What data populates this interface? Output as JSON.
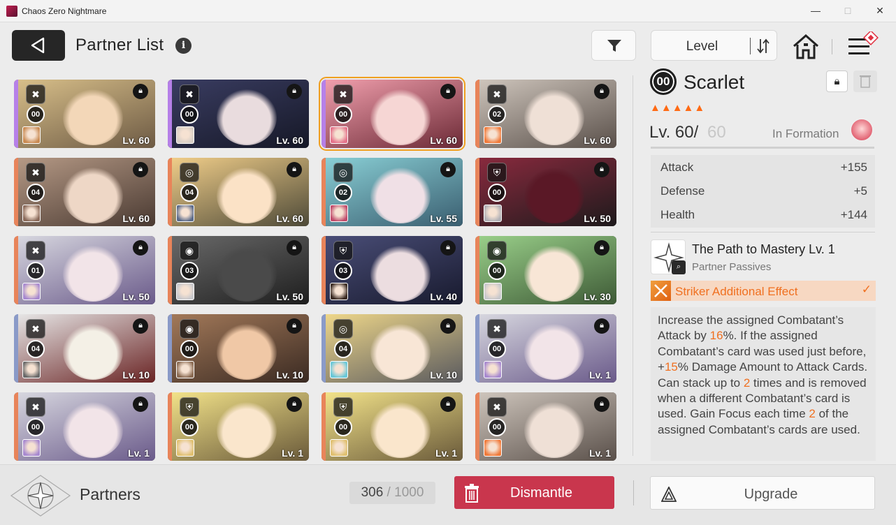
{
  "window": {
    "title": "Chaos Zero Nightmare",
    "minimize": "—",
    "maximize": "□",
    "close": "✕"
  },
  "header": {
    "title": "Partner List",
    "info_icon": "i",
    "sort_label": "Level"
  },
  "cards": [
    {
      "class_icon": "✖",
      "rank": "00",
      "level": "Lv. 60",
      "art": [
        "#d9c08a",
        "#6d5a44"
      ],
      "strip": "#b680e8",
      "face": "#f3d7b8",
      "mini": "#c98a52",
      "selected": false
    },
    {
      "class_icon": "✖",
      "rank": "00",
      "level": "Lv. 60",
      "art": [
        "#3a3d62",
        "#161827"
      ],
      "strip": "#b680e8",
      "face": "#e9dcde",
      "mini": "#d8cfc6",
      "selected": false
    },
    {
      "class_icon": "✖",
      "rank": "00",
      "level": "Lv. 60",
      "art": [
        "#f2a0ae",
        "#6c2a36"
      ],
      "strip": "#b680e8",
      "face": "#f6d6d4",
      "mini": "#e4728a",
      "selected": true
    },
    {
      "class_icon": "✖",
      "rank": "02",
      "level": "Lv. 60",
      "art": [
        "#cfc6bd",
        "#5a504a"
      ],
      "strip": "#e8845a",
      "face": "#efe0d6",
      "mini": "#f07a3a",
      "selected": false
    },
    {
      "class_icon": "✖",
      "rank": "04",
      "level": "Lv. 60",
      "art": [
        "#b69a86",
        "#4a3a32"
      ],
      "strip": "#e8845a",
      "face": "#eed7c6",
      "mini": "#8a6a5a",
      "selected": false
    },
    {
      "class_icon": "◎",
      "rank": "04",
      "level": "Lv. 60",
      "art": [
        "#f2cf8a",
        "#4e4a38"
      ],
      "strip": "#e8845a",
      "face": "#fbe2c6",
      "mini": "#5a6a8a",
      "selected": false
    },
    {
      "class_icon": "◎",
      "rank": "02",
      "level": "Lv. 55",
      "art": [
        "#8ad0d6",
        "#3a5e70"
      ],
      "strip": "#e8845a",
      "face": "#f0e0e6",
      "mini": "#c04a6a",
      "selected": false
    },
    {
      "class_icon": "⛨",
      "rank": "00",
      "level": "Lv. 50",
      "art": [
        "#8a2a3e",
        "#1e1a1c"
      ],
      "strip": "#e8845a",
      "face": "#5a1826",
      "mini": "#b0b0b6",
      "selected": false
    },
    {
      "class_icon": "✖",
      "rank": "01",
      "level": "Lv. 50",
      "art": [
        "#d8d8e0",
        "#6a5a8a"
      ],
      "strip": "#e8845a",
      "face": "#f2e4e8",
      "mini": "#a88ad0",
      "selected": false
    },
    {
      "class_icon": "◉",
      "rank": "03",
      "level": "Lv. 50",
      "art": [
        "#6a6a6a",
        "#1e1e1e"
      ],
      "strip": "#e8845a",
      "face": "#4a4a4a",
      "mini": "#c8c8cc",
      "selected": false
    },
    {
      "class_icon": "⛨",
      "rank": "03",
      "level": "Lv. 40",
      "art": [
        "#4a4e78",
        "#181a2e"
      ],
      "strip": "#e8845a",
      "face": "#ecdde0",
      "mini": "#3a2a22",
      "selected": false
    },
    {
      "class_icon": "◉",
      "rank": "00",
      "level": "Lv. 30",
      "art": [
        "#9ad08a",
        "#3e5a36"
      ],
      "strip": "#e8845a",
      "face": "#f8e6d6",
      "mini": "#c8c8cc",
      "selected": false
    },
    {
      "class_icon": "✖",
      "rank": "04",
      "level": "Lv. 10",
      "art": [
        "#e8e8e8",
        "#6a2424"
      ],
      "strip": "#8a9ac8",
      "face": "#f4f0e6",
      "mini": "#6a6a6a",
      "selected": false
    },
    {
      "class_icon": "◉",
      "rank": "00",
      "level": "Lv. 10",
      "art": [
        "#a47a5a",
        "#3a2a22"
      ],
      "strip": "#8a9ac8",
      "face": "#f0c8a6",
      "mini": "#8a6a52",
      "selected": false
    },
    {
      "class_icon": "◎",
      "rank": "04",
      "level": "Lv. 10",
      "art": [
        "#f0d88a",
        "#5a5a5e"
      ],
      "strip": "#8a9ac8",
      "face": "#f8e6d6",
      "mini": "#6ac8d8",
      "selected": false
    },
    {
      "class_icon": "✖",
      "rank": "00",
      "level": "Lv. 1",
      "art": [
        "#d8d8e0",
        "#6a5a8a"
      ],
      "strip": "#8a9ac8",
      "face": "#f2e4e8",
      "mini": "#a88ad0",
      "selected": false
    },
    {
      "class_icon": "✖",
      "rank": "00",
      "level": "Lv. 1",
      "art": [
        "#d8d8e0",
        "#6a5a8a"
      ],
      "strip": "#e8845a",
      "face": "#f2e4e8",
      "mini": "#a88ad0",
      "selected": false
    },
    {
      "class_icon": "⛨",
      "rank": "00",
      "level": "Lv. 1",
      "art": [
        "#f4e48a",
        "#6a5a3a"
      ],
      "strip": "#e8845a",
      "face": "#fae6cc",
      "mini": "#e0c070",
      "selected": false
    },
    {
      "class_icon": "⛨",
      "rank": "00",
      "level": "Lv. 1",
      "art": [
        "#f4e48a",
        "#6a5a3a"
      ],
      "strip": "#e8845a",
      "face": "#fae6cc",
      "mini": "#e0c070",
      "selected": false
    },
    {
      "class_icon": "✖",
      "rank": "00",
      "level": "Lv. 1",
      "art": [
        "#cfc6bd",
        "#5a504a"
      ],
      "strip": "#e8845a",
      "face": "#efe0d6",
      "mini": "#f07a3a",
      "selected": false
    }
  ],
  "detail": {
    "grade": "00",
    "name": "Scarlet",
    "stars": "▲▲▲▲▲",
    "level_current": "Lv. 60/",
    "level_max": "60",
    "formation_label": "In Formation",
    "stats": [
      {
        "label": "Attack",
        "value": "+155"
      },
      {
        "label": "Defense",
        "value": "+5"
      },
      {
        "label": "Health",
        "value": "+144"
      }
    ],
    "skill_name": "The Path to Mastery Lv. 1",
    "skill_sub": "Partner Passives",
    "striker_label": "Striker Additional Effect",
    "striker_check": "✓",
    "desc": {
      "p1": "Increase the assigned Combatant’s Attack by ",
      "v1": "16",
      "p2": "%. If the assigned Combatant’s card was used just before, +",
      "v2": "15",
      "p3": "% Damage Amount to Attack Cards. Can stack up to ",
      "v3": "2",
      "p4": " times and is removed when a different Combatant’s card is used. Gain Focus each time ",
      "v4": "2",
      "p5": " of the assigned Combatant’s cards are used."
    }
  },
  "bottom": {
    "category": "Partners",
    "count_current": "306",
    "count_sep": " / ",
    "count_max": "1000",
    "dismantle_label": "Dismantle",
    "upgrade_label": "Upgrade"
  },
  "colors": {
    "accent": "#f07020",
    "dismantle": "#c9364d",
    "selected_outline": "#f0a020"
  }
}
